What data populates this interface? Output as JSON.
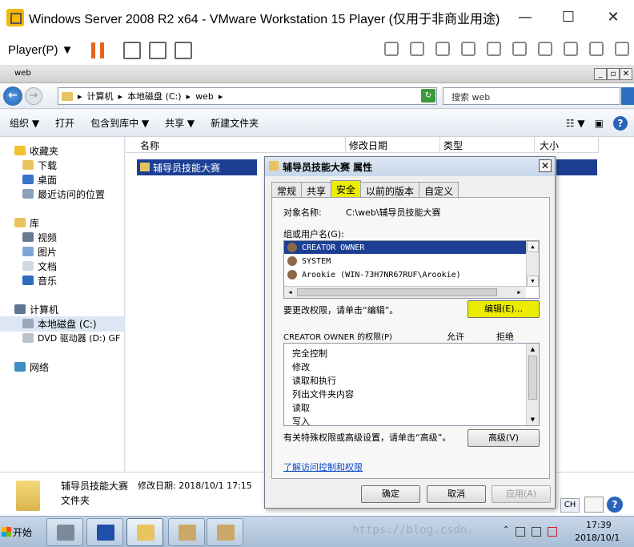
{
  "vmware": {
    "title": "Windows Server 2008 R2 x64 - VMware Workstation 15 Player (仅用于非商业用途)",
    "menu_player": "Player(P) ▼",
    "minimize": "—",
    "maximize": "☐",
    "close": "✕"
  },
  "explorer": {
    "window_title": "web",
    "address": {
      "parts": [
        "计算机",
        "本地磁盘 (C:)",
        "web"
      ],
      "separator": "▸"
    },
    "search_placeholder": "搜索 web",
    "commands": [
      "组织 ▼",
      "打开",
      "包含到库中 ▼",
      "共享 ▼",
      "新建文件夹"
    ],
    "nav": {
      "favorites": "收藏夹",
      "downloads": "下载",
      "desktop": "桌面",
      "recent": "最近访问的位置",
      "libraries": "库",
      "videos": "视频",
      "pictures": "图片",
      "documents": "文档",
      "music": "音乐",
      "computer": "计算机",
      "local_disk": "本地磁盘 (C:)",
      "dvd": "DVD 驱动器 (D:) GF",
      "network": "网络"
    },
    "columns": [
      "名称",
      "修改日期",
      "类型",
      "大小"
    ],
    "selected_file": "辅导员技能大赛",
    "details": {
      "name": "辅导员技能大赛",
      "modified": "修改日期: 2018/10/1 17:15",
      "type": "文件夹"
    }
  },
  "dialog": {
    "title": "辅导员技能大赛 属性",
    "close": "✕",
    "tabs": [
      "常规",
      "共享",
      "安全",
      "以前的版本",
      "自定义"
    ],
    "active_tab": "安全",
    "object_label": "对象名称:",
    "object_value": "C:\\web\\辅导员技能大赛",
    "group_label": "组或用户名(G):",
    "groups": [
      "CREATOR OWNER",
      "SYSTEM",
      "Arookie (WIN-73H7NR67RUF\\Arookie)"
    ],
    "edit_hint": "要更改权限，请单击“编辑”。",
    "edit_button": "编辑(E)...",
    "perm_label": "CREATOR OWNER 的权限(P)",
    "allow": "允许",
    "deny": "拒绝",
    "permissions": [
      "完全控制",
      "修改",
      "读取和执行",
      "列出文件夹内容",
      "读取",
      "写入"
    ],
    "advanced_hint": "有关特殊权限或高级设置，请单击“高级”。",
    "advanced_button": "高级(V)",
    "learn_link": "了解访问控制和权限",
    "ok": "确定",
    "cancel": "取消",
    "apply": "应用(A)"
  },
  "taskbar": {
    "start": "开始",
    "ime": "CH",
    "time": "17:39",
    "date": "2018/10/1"
  },
  "watermark": "https://blog.csdn."
}
